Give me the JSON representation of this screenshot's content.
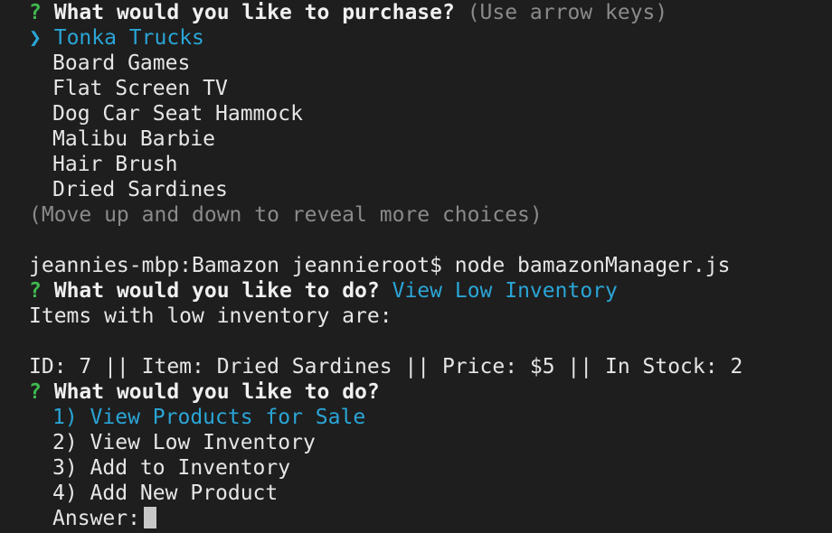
{
  "prompt1": {
    "q_mark": "?",
    "question": "What would you like to purchase?",
    "hint": "(Use arrow keys)",
    "pointer": "❯",
    "selected": "Tonka Trucks",
    "options": [
      "Board Games",
      "Flat Screen TV",
      "Dog Car Seat Hammock",
      "Malibu Barbie",
      "Hair Brush",
      "Dried Sardines"
    ],
    "more_hint": "(Move up and down to reveal more choices)"
  },
  "shell": {
    "command_line": "jeannies-mbp:Bamazon jeannieroot$ node bamazonManager.js"
  },
  "prompt2": {
    "q_mark": "?",
    "question": "What would you like to do?",
    "answer": "View Low Inventory"
  },
  "output": {
    "header": "Items with low inventory are:",
    "row": "ID: 7 || Item: Dried Sardines || Price: $5 || In Stock: 2"
  },
  "prompt3": {
    "q_mark": "?",
    "question": "What would you like to do?",
    "options": [
      "1) View Products for Sale",
      "2) View Low Inventory",
      "3) Add to Inventory",
      "4) Add New Product"
    ],
    "answer_label": "Answer:"
  },
  "colors": {
    "background": "#1e1e1e",
    "text": "#e6e6e6",
    "question_mark": "#3fb950",
    "highlight": "#2aa5d6",
    "dim": "#8a8a8a"
  }
}
